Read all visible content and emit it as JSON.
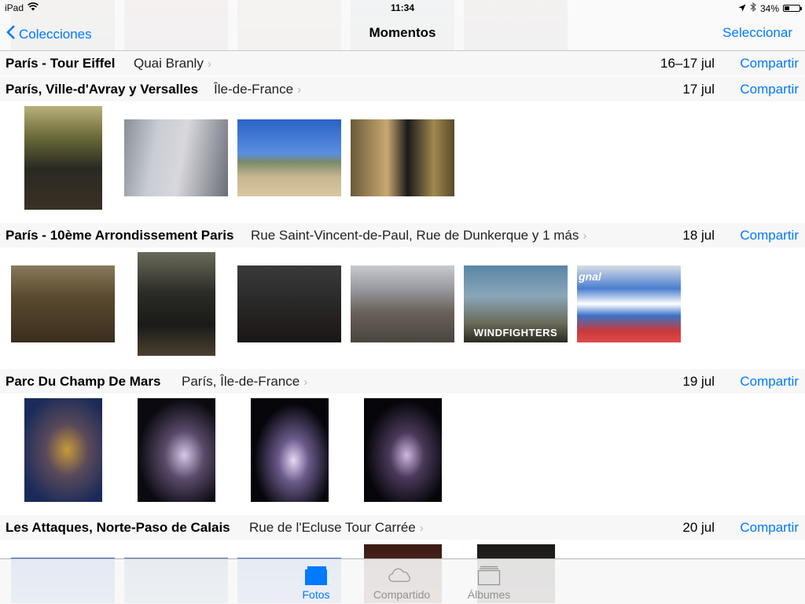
{
  "status_bar": {
    "device": "iPad",
    "time": "11:34",
    "battery": "34%",
    "battery_level": 0.34
  },
  "nav": {
    "back_label": "Colecciones",
    "title": "Momentos",
    "select_label": "Seleccionar"
  },
  "moments": [
    {
      "title": "París - Tour Eiffel",
      "location": "Quai Branly",
      "date": "16–17 jul",
      "share": "Compartir"
    },
    {
      "title": "París, Ville-d'Avray y Versalles",
      "location": "Île-de-France",
      "date": "17 jul",
      "share": "Compartir"
    },
    {
      "title": "París - 10ème Arrondissement Paris",
      "location": "Rue Saint-Vincent-de-Paul, Rue de Dunkerque y 1 más",
      "date": "18 jul",
      "share": "Compartir"
    },
    {
      "title": "Parc Du Champ De Mars",
      "location": "París, Île-de-France",
      "date": "19 jul",
      "share": "Compartir"
    },
    {
      "title": "Les Attaques, Norte-Paso de Calais",
      "location": "Rue de l'Ecluse Tour Carrée",
      "date": "20 jul",
      "share": "Compartir"
    }
  ],
  "photo_text": {
    "poster_caption": "WINDFIGHTERS",
    "box_text": "gnal"
  },
  "tabs": [
    {
      "label": "Fotos",
      "active": true
    },
    {
      "label": "Compartido",
      "active": false
    },
    {
      "label": "Álbumes",
      "active": false
    }
  ],
  "colors": {
    "accent": "#007aff",
    "inactive": "#929292"
  }
}
